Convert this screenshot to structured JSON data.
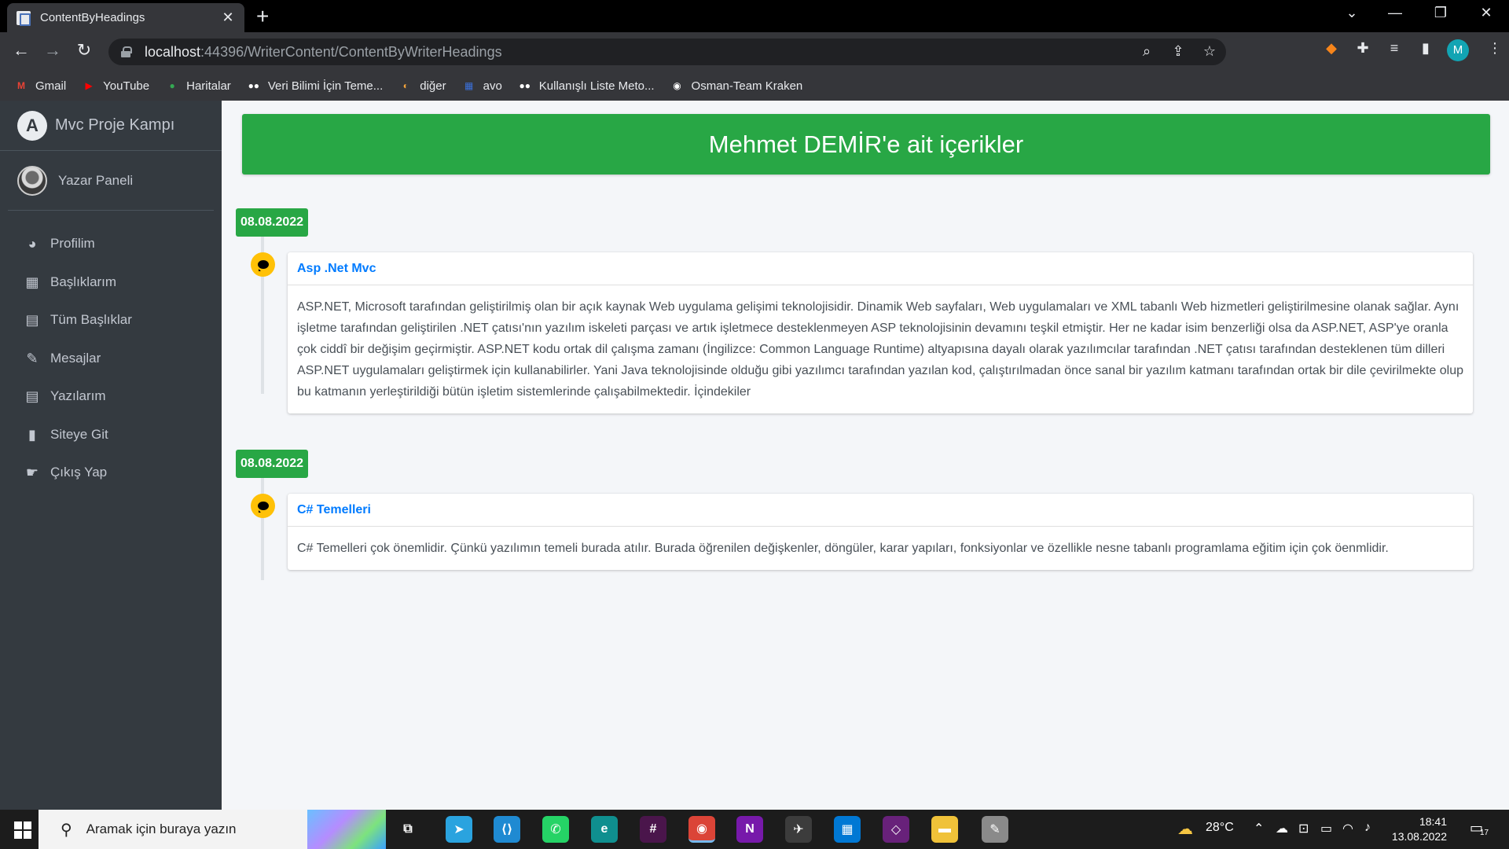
{
  "browser": {
    "tab_title": "ContentByHeadings",
    "tab_close": "✕",
    "new_tab": "+",
    "url_host": "localhost",
    "url_path": ":44396/WriterContent/ContentByWriterHeadings",
    "profile_initial": "M",
    "bookmarks": [
      {
        "label": "Gmail",
        "icon": "gmail-icon",
        "glyph": "M",
        "color": "#ea4335"
      },
      {
        "label": "YouTube",
        "icon": "youtube-icon",
        "glyph": "▶",
        "color": "#ff0000"
      },
      {
        "label": "Haritalar",
        "icon": "maps-pin-icon",
        "glyph": "●",
        "color": "#34a853"
      },
      {
        "label": "Veri Bilimi İçin Teme...",
        "icon": "medium-icon",
        "glyph": "●●",
        "color": "#ffffff"
      },
      {
        "label": "diğer",
        "icon": "folder-icon",
        "glyph": "◐",
        "color": "#f2a33a"
      },
      {
        "label": "avo",
        "icon": "avo-icon",
        "glyph": "▦",
        "color": "#3b6fd6"
      },
      {
        "label": "Kullanışlı Liste Meto...",
        "icon": "medium-icon",
        "glyph": "●●",
        "color": "#ffffff"
      },
      {
        "label": "Osman-Team Kraken",
        "icon": "github-icon",
        "glyph": "◉",
        "color": "#ffffff"
      }
    ]
  },
  "sidebar": {
    "brand": "Mvc Proje Kampı",
    "brand_logo": "A",
    "user": "Yazar Paneli",
    "items": [
      {
        "label": "Profilim",
        "icon": "dashboard-icon",
        "glyph": "◕"
      },
      {
        "label": "Başlıklarım",
        "icon": "grid-icon",
        "glyph": "▦"
      },
      {
        "label": "Tüm Başlıklar",
        "icon": "table-icon",
        "glyph": "▤"
      },
      {
        "label": "Mesajlar",
        "icon": "edit-icon",
        "glyph": "✎"
      },
      {
        "label": "Yazılarım",
        "icon": "table-icon",
        "glyph": "▤"
      },
      {
        "label": "Siteye Git",
        "icon": "book-icon",
        "glyph": "▮"
      },
      {
        "label": "Çıkış Yap",
        "icon": "hand-point-icon",
        "glyph": "☛"
      }
    ]
  },
  "main": {
    "header": "Mehmet DEMİR'e ait içerikler",
    "entries": [
      {
        "date": "08.08.2022",
        "title": "Asp .Net Mvc",
        "text": "ASP.NET, Microsoft tarafından geliştirilmiş olan bir açık kaynak Web uygulama gelişimi teknolojisidir. Dinamik Web sayfaları, Web uygulamaları ve XML tabanlı Web hizmetleri geliştirilmesine olanak sağlar. Aynı işletme tarafından geliştirilen .NET çatısı'nın yazılım iskeleti parçası ve artık işletmece desteklenmeyen ASP teknolojisinin devamını teşkil etmiştir. Her ne kadar isim benzerliği olsa da ASP.NET, ASP'ye oranla çok ciddî bir değişim geçirmiştir. ASP.NET kodu ortak dil çalışma zamanı (İngilizce: Common Language Runtime) altyapısına dayalı olarak yazılımcılar tarafından .NET çatısı tarafından desteklenen tüm dilleri ASP.NET uygulamaları geliştirmek için kullanabilirler. Yani Java teknolojisinde olduğu gibi yazılımcı tarafından yazılan kod, çalıştırılmadan önce sanal bir yazılım katmanı tarafından ortak bir dile çevirilmekte olup bu katmanın yerleştirildiği bütün işletim sistemlerinde çalışabilmektedir. İçindekiler"
      },
      {
        "date": "08.08.2022",
        "title": "C# Temelleri",
        "text": "C# Temelleri çok önemlidir. Çünkü yazılımın temeli burada atılır. Burada öğrenilen değişkenler, döngüler, karar yapıları, fonksiyonlar ve özellikle nesne tabanlı programlama eğitim için çok öenmlidir."
      }
    ]
  },
  "taskbar": {
    "search_placeholder": "Aramak için buraya yazın",
    "weather": "28°C",
    "time": "18:41",
    "date": "13.08.2022",
    "notifications": "17",
    "apps": [
      {
        "name": "task-view-icon",
        "glyph": "⧉",
        "bg": "transparent"
      },
      {
        "name": "telegram-icon",
        "glyph": "➤",
        "bg": "#2aa3df"
      },
      {
        "name": "vscode-icon",
        "glyph": "⟨⟩",
        "bg": "#1f8ad2"
      },
      {
        "name": "whatsapp-icon",
        "glyph": "✆",
        "bg": "#25d366"
      },
      {
        "name": "edge-icon",
        "glyph": "e",
        "bg": "#0f8f8f"
      },
      {
        "name": "slack-icon",
        "glyph": "#",
        "bg": "#4a154b"
      },
      {
        "name": "chrome-icon",
        "glyph": "◉",
        "bg": "#db4437"
      },
      {
        "name": "onenote-icon",
        "glyph": "N",
        "bg": "#7719aa"
      },
      {
        "name": "app-icon",
        "glyph": "✈",
        "bg": "#3c3c3c"
      },
      {
        "name": "store-icon",
        "glyph": "▦",
        "bg": "#0078d4"
      },
      {
        "name": "visual-studio-icon",
        "glyph": "◇",
        "bg": "#68217a"
      },
      {
        "name": "file-explorer-icon",
        "glyph": "▬",
        "bg": "#f0c239"
      },
      {
        "name": "paint-icon",
        "glyph": "✎",
        "bg": "#8a8a8a"
      }
    ]
  }
}
